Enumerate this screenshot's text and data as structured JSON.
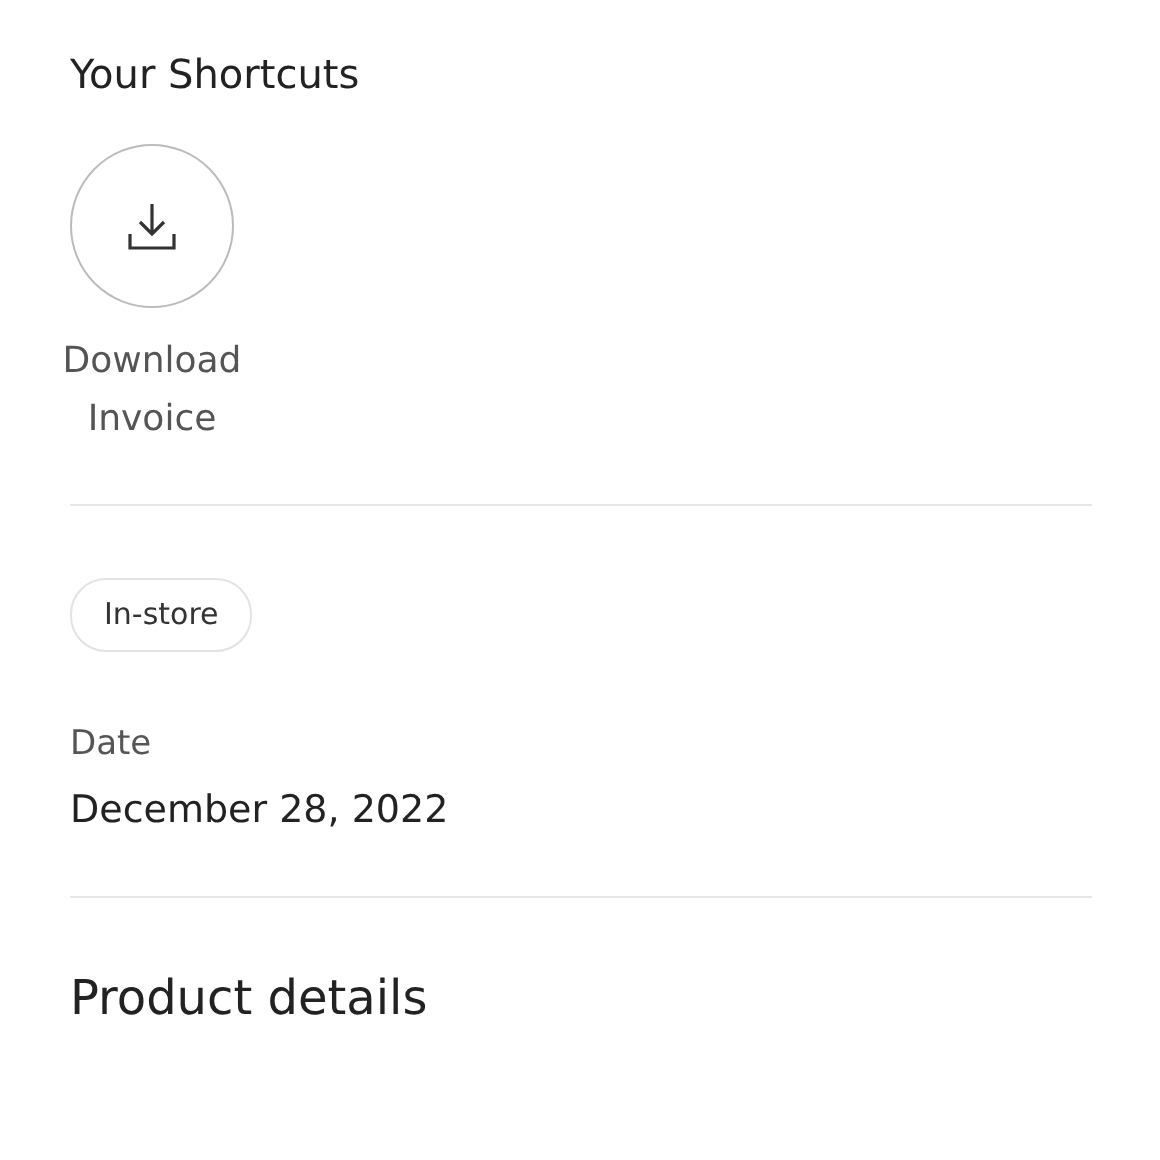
{
  "shortcuts": {
    "title": "Your Shortcuts",
    "items": [
      {
        "label": "Download Invoice"
      }
    ]
  },
  "tag": "In-store",
  "date": {
    "label": "Date",
    "value": "December 28, 2022"
  },
  "product_details": {
    "title": "Product details"
  }
}
